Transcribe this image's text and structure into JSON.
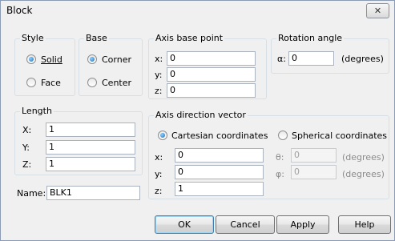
{
  "window": {
    "title": "Block",
    "close_glyph": "✕"
  },
  "style_group": {
    "label": "Style",
    "options": [
      {
        "label": "Solid",
        "selected": true
      },
      {
        "label": "Face",
        "selected": false
      }
    ]
  },
  "base_group": {
    "label": "Base",
    "options": [
      {
        "label": "Corner",
        "selected": true
      },
      {
        "label": "Center",
        "selected": false
      }
    ]
  },
  "axis_base_point": {
    "label": "Axis base point",
    "x_label": "x:",
    "x_value": "0",
    "y_label": "y:",
    "y_value": "0",
    "z_label": "z:",
    "z_value": "0"
  },
  "rotation_angle": {
    "label": "Rotation angle",
    "alpha_label": "α:",
    "value": "0",
    "unit": "(degrees)"
  },
  "length_group": {
    "label": "Length",
    "x_label": "X:",
    "x_value": "1",
    "y_label": "Y:",
    "y_value": "1",
    "z_label": "Z:",
    "z_value": "1"
  },
  "axis_direction": {
    "label": "Axis direction vector",
    "cartesian_label": "Cartesian coordinates",
    "cartesian_selected": true,
    "spherical_label": "Spherical coordinates",
    "spherical_selected": false,
    "x_label": "x:",
    "x_value": "0",
    "y_label": "y:",
    "y_value": "0",
    "z_label": "z:",
    "z_value": "1",
    "theta_label": "θ:",
    "theta_value": "0",
    "theta_unit": "(degrees)",
    "phi_label": "φ:",
    "phi_value": "0",
    "phi_unit": "(degrees)"
  },
  "name_field": {
    "label": "Name:",
    "value": "BLK1"
  },
  "buttons": {
    "ok": "OK",
    "cancel": "Cancel",
    "apply": "Apply",
    "help": "Help"
  }
}
